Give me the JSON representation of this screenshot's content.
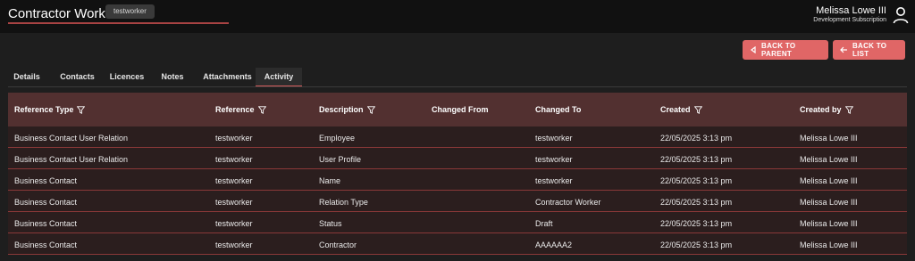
{
  "header": {
    "title": "Contractor Worker",
    "badge": "testworker",
    "user_name": "Melissa Lowe III",
    "user_subscription": "Development Subscription"
  },
  "actions": {
    "back_to_parent": "BACK TO PARENT",
    "back_to_list": "BACK TO LIST"
  },
  "tabs": [
    {
      "label": "Details"
    },
    {
      "label": "Contacts"
    },
    {
      "label": "Licences"
    },
    {
      "label": "Notes"
    },
    {
      "label": "Attachments"
    },
    {
      "label": "Activity",
      "active": true
    }
  ],
  "table": {
    "columns": [
      {
        "label": "Reference Type",
        "filter": true
      },
      {
        "label": "Reference",
        "filter": true
      },
      {
        "label": "Description",
        "filter": true
      },
      {
        "label": "Changed From",
        "filter": false
      },
      {
        "label": "Changed To",
        "filter": false
      },
      {
        "label": "Created",
        "filter": true
      },
      {
        "label": "Created by",
        "filter": true
      }
    ],
    "rows": [
      [
        "Business Contact User Relation",
        "testworker",
        "Employee",
        "",
        "testworker",
        "22/05/2025 3:13 pm",
        "Melissa Lowe III"
      ],
      [
        "Business Contact User Relation",
        "testworker",
        "User Profile",
        "",
        "testworker",
        "22/05/2025 3:13 pm",
        "Melissa Lowe III"
      ],
      [
        "Business Contact",
        "testworker",
        "Name",
        "",
        "testworker",
        "22/05/2025 3:13 pm",
        "Melissa Lowe III"
      ],
      [
        "Business Contact",
        "testworker",
        "Relation Type",
        "",
        "Contractor Worker",
        "22/05/2025 3:13 pm",
        "Melissa Lowe III"
      ],
      [
        "Business Contact",
        "testworker",
        "Status",
        "",
        "Draft",
        "22/05/2025 3:13 pm",
        "Melissa Lowe III"
      ],
      [
        "Business Contact",
        "testworker",
        "Contractor",
        "",
        "AAAAAA2",
        "22/05/2025 3:13 pm",
        "Melissa Lowe III"
      ]
    ]
  },
  "colors": {
    "accent": "#e06666",
    "header_row": "#523030",
    "row_bg": "#2b1e1e",
    "row_border": "#8a3838"
  }
}
